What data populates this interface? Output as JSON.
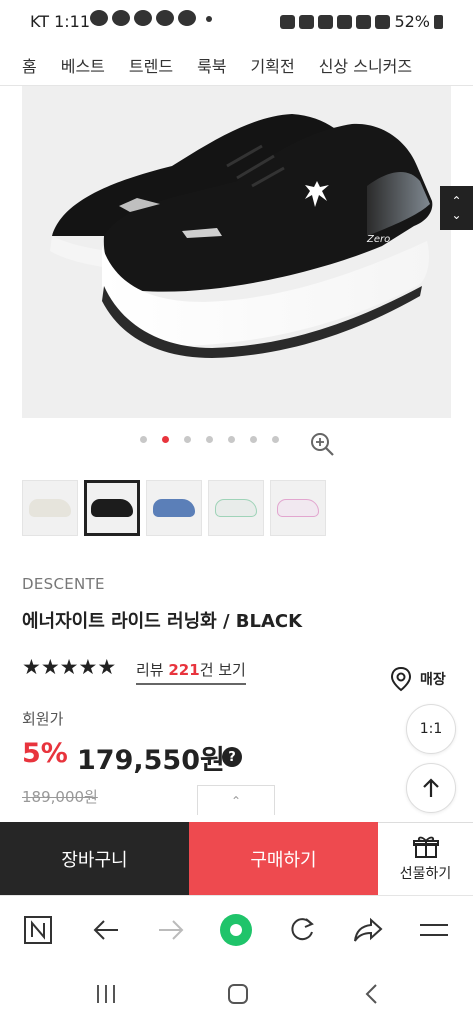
{
  "status_bar": {
    "carrier_time": "KT 1:11",
    "battery": "52%"
  },
  "top_nav": {
    "items": [
      "홈",
      "베스트",
      "트렌드",
      "룩북",
      "기획전",
      "신상 스니커즈"
    ]
  },
  "gallery": {
    "image_label": "Zero",
    "dots_total": 7,
    "active_dot": 2,
    "thumbnails": [
      {
        "color": "#e6e4dc"
      },
      {
        "color": "#1c1c1c"
      },
      {
        "color": "#5b7fb8"
      },
      {
        "color": "#e8ecea"
      },
      {
        "color": "#f1e8f0"
      }
    ],
    "selected_thumbnail": 2
  },
  "product": {
    "brand": "DESCENTE",
    "name": "에너자이트 라이드 러닝화 / BLACK",
    "rating_stars": 5,
    "review_prefix": "리뷰 ",
    "review_count": "221",
    "review_suffix": "건 보기",
    "store_label": "매장",
    "member_price_label": "회원가",
    "discount": "5%",
    "price": "179,550원",
    "original_price": "189,000원"
  },
  "floating": {
    "chat_label": "1:1"
  },
  "actions": {
    "cart_label": "장바구니",
    "buy_label": "구매하기",
    "gift_label": "선물하기"
  },
  "colors": {
    "accent_red": "#e8343d",
    "buy_button": "#ee4a4f",
    "cart_button": "#262626",
    "browser_green": "#1fc46a"
  },
  "browser_toolbar": {
    "icons": [
      "naver-home-icon",
      "back-arrow-icon",
      "forward-arrow-icon",
      "green-dot-icon",
      "refresh-icon",
      "share-icon",
      "menu-icon"
    ]
  }
}
